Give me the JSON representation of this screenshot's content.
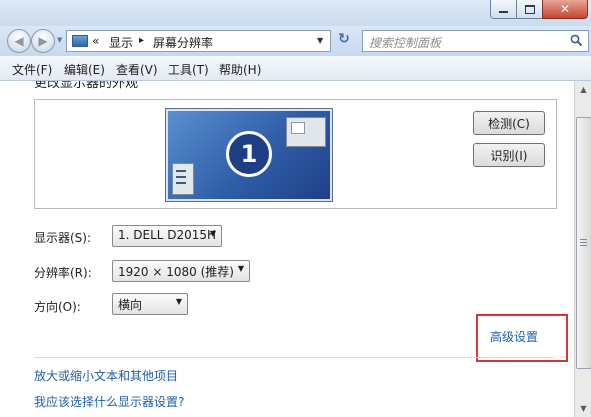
{
  "window": {
    "controls": {
      "minimize_icon": "minimize-icon",
      "maximize_icon": "maximize-icon",
      "close_glyph": "✕"
    }
  },
  "nav": {
    "back_glyph": "◀",
    "forward_glyph": "▶",
    "breadcrumb_sep": "«",
    "breadcrumb": [
      "显示",
      "屏幕分辨率"
    ],
    "crumb_arrow": "▸",
    "refresh_glyph": "↻",
    "search_placeholder": "搜索控制面板"
  },
  "menu": {
    "items": [
      "文件(F)",
      "编辑(E)",
      "查看(V)",
      "工具(T)",
      "帮助(H)"
    ]
  },
  "content": {
    "heading": "更改显示器的外观",
    "monitor_number": "1",
    "buttons": {
      "detect": "检测(C)",
      "identify": "识别(I)"
    },
    "display_label": "显示器(S):",
    "display_value": "1. DELL D2015H",
    "resolution_label": "分辨率(R):",
    "resolution_value": "1920 × 1080 (推荐)",
    "orientation_label": "方向(O):",
    "orientation_value": "横向",
    "advanced_link": "高级设置",
    "links": [
      "放大或缩小文本和其他项目",
      "我应该选择什么显示器设置?"
    ]
  },
  "colors": {
    "link": "#1f5fa8",
    "highlight_border": "#d9343a",
    "monitor_fill": "#2f5ea8"
  }
}
